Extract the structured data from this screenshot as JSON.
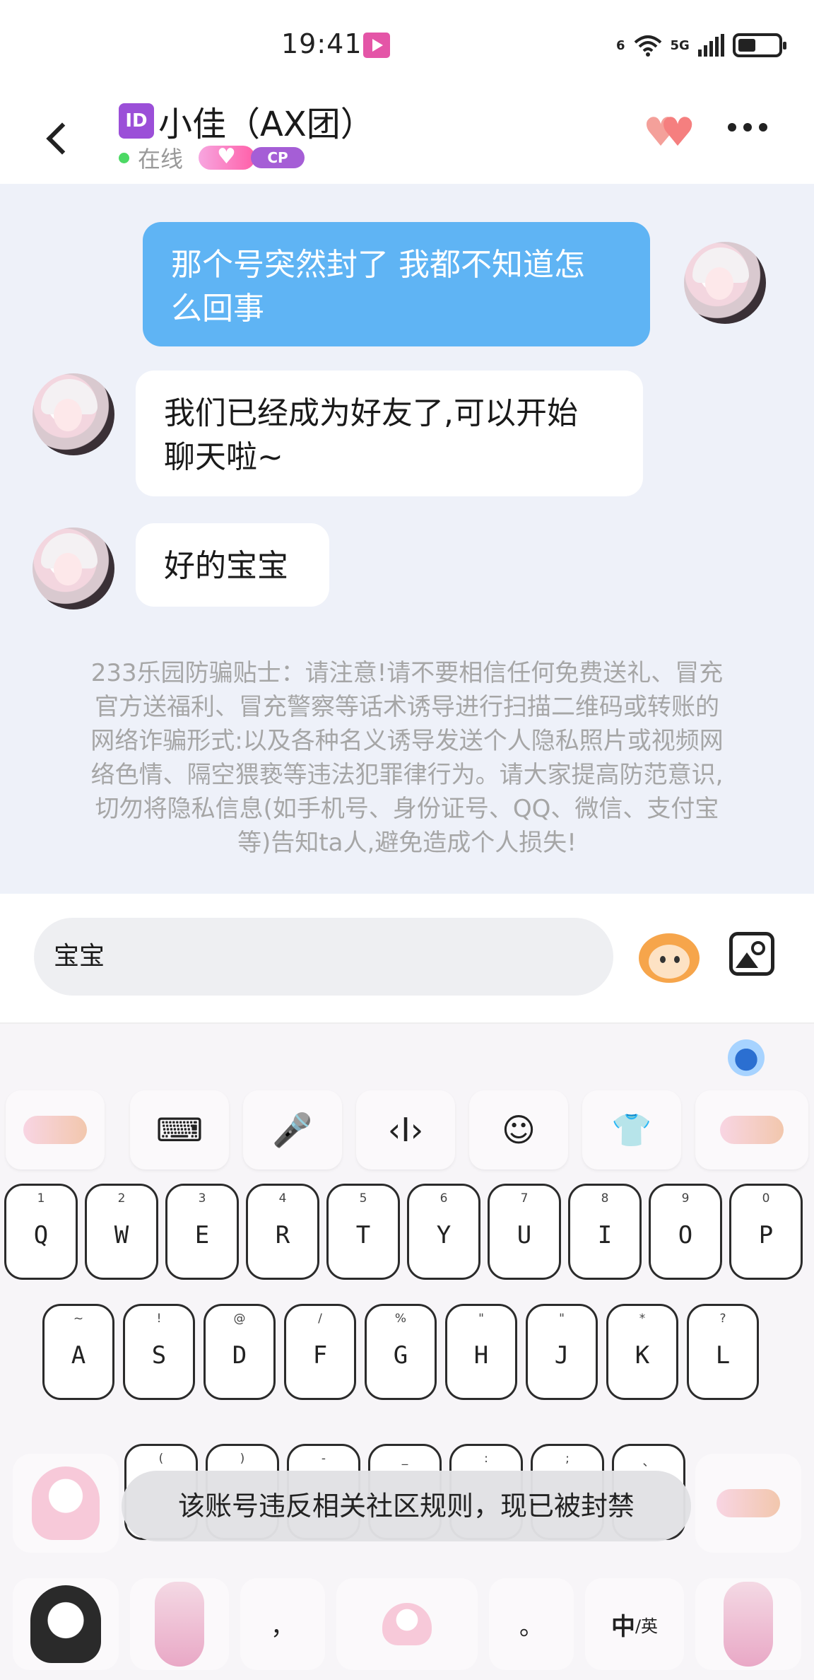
{
  "status_bar": {
    "time": "19:41",
    "network": "5G",
    "wifi_label": "6",
    "battery_percent": 45
  },
  "header": {
    "back_icon": "chevron-left-icon",
    "id_badge": "ID",
    "contact_name": "小佳（AX团）",
    "status_text": "在线",
    "cp_badge": "CP",
    "accent_color": "#5fb4f4"
  },
  "messages": [
    {
      "from": "me",
      "text_line1": "那个号突然封了 我都不知道怎",
      "text_line2": "么回事"
    },
    {
      "from": "them",
      "text_line1": "我们已经成为好友了,可以开始",
      "text_line2": "聊天啦~"
    },
    {
      "from": "them",
      "text_line1": "好的宝宝"
    }
  ],
  "safety_notice": {
    "lines": [
      "233乐园防骗贴士：请注意!请不要相信任何免费送礼、冒充",
      "官方送福利、冒充警察等话术诱导进行扫描二维码或转账的",
      "网络诈骗形式:以及各种名义诱导发送个人隐私照片或视频网",
      "络色情、隔空猥亵等违法犯罪律行为。请大家提高防范意识,",
      "切勿将隐私信息(如手机号、身份证号、QQ、微信、支付宝",
      "等)告知ta人,避免造成个人损失!"
    ]
  },
  "composer": {
    "input_value": "宝宝"
  },
  "keyboard": {
    "toolbar_icons": [
      "keyboard-icon",
      "microphone-icon",
      "cursor-icon",
      "smiley-icon",
      "ifly-shirt-icon"
    ],
    "tool_glyphs": [
      "⌨",
      "🎤",
      "‹I›",
      "☺",
      "👕"
    ],
    "row1": [
      {
        "num": "1",
        "letter": "Q"
      },
      {
        "num": "2",
        "letter": "W"
      },
      {
        "num": "3",
        "letter": "E"
      },
      {
        "num": "4",
        "letter": "R"
      },
      {
        "num": "5",
        "letter": "T"
      },
      {
        "num": "6",
        "letter": "Y"
      },
      {
        "num": "7",
        "letter": "U"
      },
      {
        "num": "8",
        "letter": "I"
      },
      {
        "num": "9",
        "letter": "O"
      },
      {
        "num": "0",
        "letter": "P"
      }
    ],
    "row2": [
      {
        "num": "~",
        "letter": "A"
      },
      {
        "num": "!",
        "letter": "S"
      },
      {
        "num": "@",
        "letter": "D"
      },
      {
        "num": "/",
        "letter": "F"
      },
      {
        "num": "%",
        "letter": "G"
      },
      {
        "num": "\"",
        "letter": "H"
      },
      {
        "num": "\"",
        "letter": "J"
      },
      {
        "num": "*",
        "letter": "K"
      },
      {
        "num": "?",
        "letter": "L"
      }
    ],
    "row3_subs": [
      "(",
      ")",
      "-",
      "_",
      ":",
      ";",
      "、"
    ],
    "comma": "，",
    "period": "。",
    "lang_switch_main": "中",
    "lang_switch_sub": "/英"
  },
  "toast": {
    "text": "该账号违反相关社区规则，现已被封禁"
  }
}
